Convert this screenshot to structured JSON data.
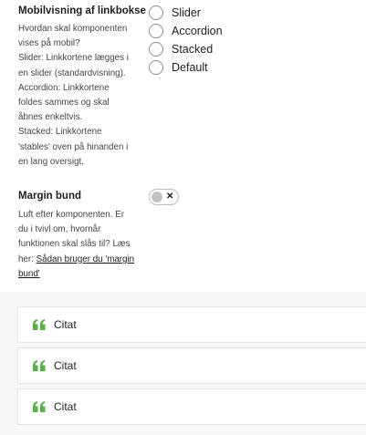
{
  "linkbox_setting": {
    "label": "Mobilvisning af linkbokse",
    "description_lines": [
      "Hvordan skal komponenten",
      "vises på mobil?",
      "Slider: Linkkortene lægges i",
      "en slider (standardvisning).",
      "Accordion: Linkkortene",
      "foldes sammes og skal",
      "åbnes enkeltvis.",
      "Stacked: Linkkortene",
      "'stables' oven på hinanden i",
      "en lang oversigt."
    ],
    "options": [
      "Slider",
      "Accordion",
      "Stacked",
      "Default"
    ]
  },
  "margin_setting": {
    "label": "Margin bund",
    "description_lines": [
      "Luft efter komponenten. Er",
      "du i tvivl om, hvornår",
      "funktionen skal slås til? Læs"
    ],
    "link_prefix": "her: ",
    "link_text_line1": "Sådan bruger du 'margin",
    "link_text_line2": "bund'",
    "toggle_symbol": "✕",
    "toggle_on": false
  },
  "blocks": [
    {
      "label": "Citat",
      "icon": "quote-icon"
    },
    {
      "label": "Citat",
      "icon": "quote-icon"
    },
    {
      "label": "Citat",
      "icon": "quote-icon"
    }
  ],
  "colors": {
    "quote_icon": "#5bb04a",
    "text": "#1e1e1e",
    "border": "#e4e4e4"
  }
}
